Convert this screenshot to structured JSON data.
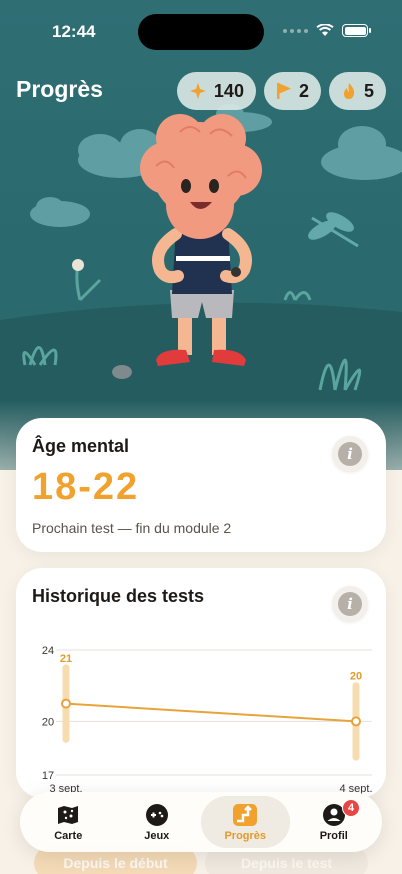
{
  "status": {
    "time": "12:44"
  },
  "header": {
    "title": "Progrès",
    "chips": [
      {
        "icon": "sparkle-icon",
        "value": "140"
      },
      {
        "icon": "flag-icon",
        "value": "2"
      },
      {
        "icon": "flame-icon",
        "value": "5"
      }
    ]
  },
  "mental_age": {
    "title": "Âge mental",
    "value": "18-22",
    "subtitle": "Prochain test — fin du module 2"
  },
  "history": {
    "title": "Historique des tests",
    "chart_data": {
      "type": "line",
      "x": [
        "3 sept.",
        "4 sept."
      ],
      "series": [
        {
          "values": [
            21,
            20
          ],
          "range_low": [
            19,
            18
          ],
          "range_high": [
            23,
            22
          ]
        }
      ],
      "y_ticks": [
        "24",
        "20",
        "17"
      ],
      "ylim": [
        17,
        24
      ],
      "grid": true,
      "color": "#e8a33a"
    }
  },
  "segmented": {
    "left": "Depuis le début",
    "right": "Depuis le test"
  },
  "tabbar": {
    "items": [
      {
        "label": "Carte",
        "icon": "map-icon"
      },
      {
        "label": "Jeux",
        "icon": "gamepad-icon"
      },
      {
        "label": "Progrès",
        "icon": "chart-up-icon",
        "active": true
      },
      {
        "label": "Profil",
        "icon": "profile-icon",
        "badge": "4"
      }
    ]
  },
  "colors": {
    "accent": "#f0a12e",
    "hero_bg": "#2e6d72",
    "badge": "#e84545"
  }
}
